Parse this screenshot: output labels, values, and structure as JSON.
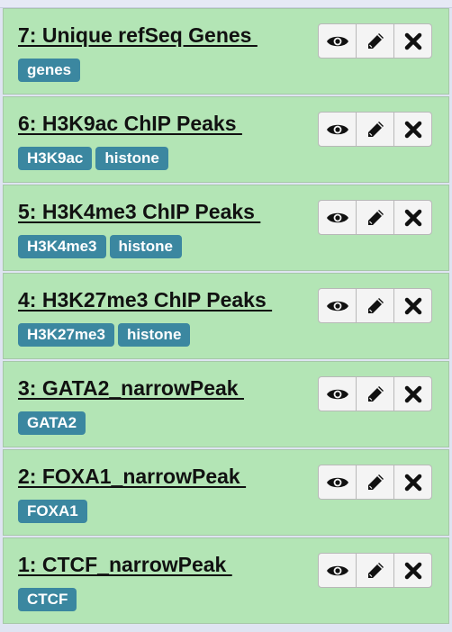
{
  "datasets": [
    {
      "title": "7: Unique refSeq Genes ",
      "tags": [
        "genes"
      ],
      "icons": [
        "eye-icon",
        "pencil-icon",
        "x-icon"
      ]
    },
    {
      "title": "6: H3K9ac ChIP Peaks ",
      "tags": [
        "H3K9ac",
        "histone"
      ],
      "icons": [
        "eye-icon",
        "pencil-icon",
        "x-icon"
      ]
    },
    {
      "title": "5: H3K4me3 ChIP Peaks ",
      "tags": [
        "H3K4me3",
        "histone"
      ],
      "icons": [
        "eye-icon",
        "pencil-icon",
        "x-icon"
      ]
    },
    {
      "title": "4: H3K27me3 ChIP Peaks ",
      "tags": [
        "H3K27me3",
        "histone"
      ],
      "icons": [
        "eye-icon",
        "pencil-icon",
        "x-icon"
      ]
    },
    {
      "title": "3: GATA2_narrowPeak ",
      "tags": [
        "GATA2"
      ],
      "icons": [
        "eye-icon",
        "pencil-icon",
        "x-icon"
      ]
    },
    {
      "title": "2: FOXA1_narrowPeak ",
      "tags": [
        "FOXA1"
      ],
      "icons": [
        "eye-icon",
        "pencil-icon",
        "x-icon"
      ]
    },
    {
      "title": "1: CTCF_narrowPeak ",
      "tags": [
        "CTCF"
      ],
      "icons": [
        "eye-icon",
        "pencil-icon",
        "x-icon"
      ]
    }
  ],
  "colors": {
    "item_background": "#b3e5b5",
    "tag_background": "#3b87a0",
    "tag_text": "#ffffff",
    "button_background": "#f4f4f4"
  }
}
